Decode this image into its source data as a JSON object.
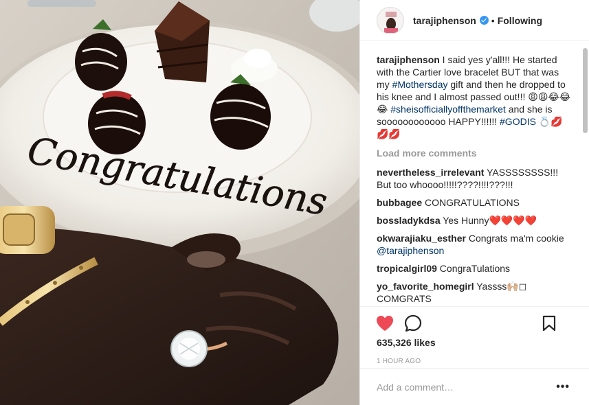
{
  "post": {
    "photo_text": "Congratulations",
    "header": {
      "username": "tarajiphenson",
      "separator": "•",
      "follow_status": "Following"
    },
    "caption": {
      "username": "tarajiphenson",
      "parts": [
        " I said yes y'all!!! He started with the Cartier love bracelet BUT that was my ",
        "#Mothersday",
        " gift and then he dropped to his knee and I almost passed out!!! 😩😩😂😂😂 ",
        "#sheisofficiallyoffthemarket",
        " and she is soooooooooooo HAPPY!!!!!! ",
        "#GODIS",
        " 💍💋💋💋"
      ]
    },
    "load_more": "Load more comments",
    "comments": [
      {
        "username": "nevertheless_irrelevant",
        "text": " YASSSSSSSS!!! But too whoooo!!!!!????!!!!???!!!"
      },
      {
        "username": "bubbagee",
        "text": " CONGRATULATIONS"
      },
      {
        "username": "bossladykdsa",
        "text": " Yes Hunny❤️❤️❤️❤️"
      },
      {
        "username": "okwarajiaku_esther",
        "text": " Congrats ma'm cookie ",
        "mention": "@tarajiphenson"
      },
      {
        "username": "tropicalgirl09",
        "text": " CongraTulations"
      },
      {
        "username": "yo_favorite_homegirl",
        "text": " Yassss🙌🏼◻ COMGRATS"
      }
    ],
    "likes": "635,326 likes",
    "time": "1 HOUR AGO",
    "comment_placeholder": "Add a comment…",
    "more_label": "•••"
  },
  "colors": {
    "heart": "#ed4956",
    "verified": "#3897f0",
    "hashtag": "#003569",
    "muted": "#999999"
  },
  "icons": [
    "heart-icon",
    "comment-icon",
    "bookmark-icon",
    "verified-icon",
    "more-icon"
  ]
}
